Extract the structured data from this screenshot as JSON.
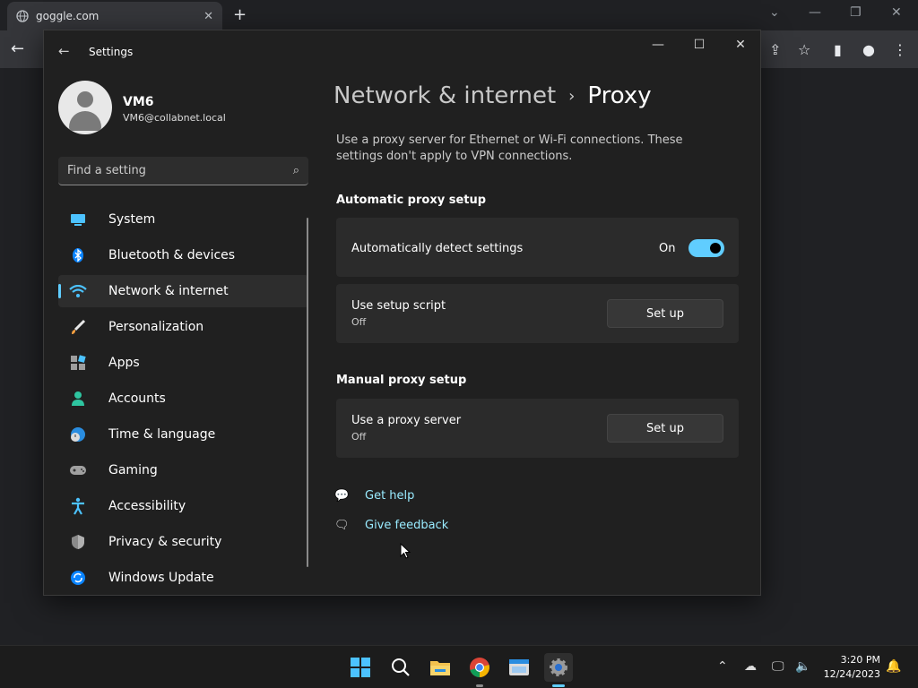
{
  "browser": {
    "tab_title": "goggle.com",
    "tab_close": "✕",
    "new_tab": "+",
    "minimize": "—",
    "restore": "❐",
    "close": "✕",
    "back": "←"
  },
  "settings": {
    "title": "Settings",
    "user": {
      "name": "VM6",
      "email": "VM6@collabnet.local"
    },
    "search_placeholder": "Find a setting",
    "nav": [
      {
        "label": "System",
        "icon": "system-icon"
      },
      {
        "label": "Bluetooth & devices",
        "icon": "bluetooth-icon"
      },
      {
        "label": "Network & internet",
        "icon": "wifi-icon"
      },
      {
        "label": "Personalization",
        "icon": "brush-icon"
      },
      {
        "label": "Apps",
        "icon": "apps-icon"
      },
      {
        "label": "Accounts",
        "icon": "person-icon"
      },
      {
        "label": "Time & language",
        "icon": "globe-clock-icon"
      },
      {
        "label": "Gaming",
        "icon": "gamepad-icon"
      },
      {
        "label": "Accessibility",
        "icon": "accessibility-icon"
      },
      {
        "label": "Privacy & security",
        "icon": "shield-icon"
      },
      {
        "label": "Windows Update",
        "icon": "update-icon"
      }
    ],
    "active_nav": "Network & internet"
  },
  "content": {
    "breadcrumb_parent": "Network & internet",
    "breadcrumb_sep": "›",
    "breadcrumb_current": "Proxy",
    "description": "Use a proxy server for Ethernet or Wi-Fi connections. These settings don't apply to VPN connections.",
    "auto_section": "Automatic proxy setup",
    "auto_detect_label": "Automatically detect settings",
    "auto_detect_state": "On",
    "setup_script_label": "Use setup script",
    "setup_script_state": "Off",
    "setup_button": "Set up",
    "manual_section": "Manual proxy setup",
    "proxy_server_label": "Use a proxy server",
    "proxy_server_state": "Off",
    "get_help": "Get help",
    "give_feedback": "Give feedback"
  },
  "taskbar": {
    "time": "3:20 PM",
    "date": "12/24/2023"
  },
  "colors": {
    "accent": "#60cdff",
    "link": "#99ebff",
    "card": "#2b2b2b",
    "background": "#202020"
  }
}
